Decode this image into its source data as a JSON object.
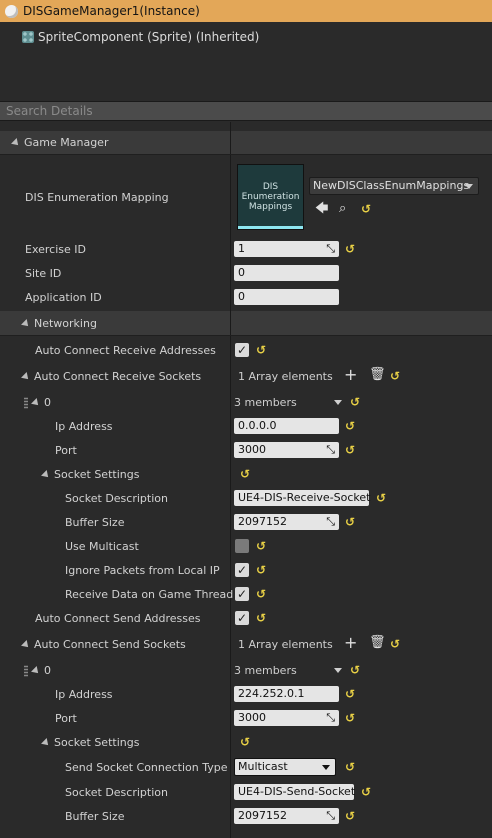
{
  "header": {
    "title": "DISGameManager1(Instance)",
    "component": "SpriteComponent (Sprite) (Inherited)"
  },
  "search": {
    "placeholder": "Search Details"
  },
  "game_manager": {
    "category": "Game Manager",
    "dis_enum_label": "DIS Enumeration Mapping",
    "thumbnail_text": [
      "DIS",
      "Enumeration",
      "Mappings"
    ],
    "asset_name": "NewDISClassEnumMappings",
    "exercise_label": "Exercise ID",
    "exercise_value": "1",
    "site_label": "Site ID",
    "site_value": "0",
    "application_label": "Application ID",
    "application_value": "0"
  },
  "networking": {
    "category": "Networking",
    "recv_addresses_label": "Auto Connect Receive Addresses",
    "recv_sockets_label": "Auto Connect Receive Sockets",
    "recv_sockets_count": "1 Array elements",
    "recv_index": "0",
    "recv_members": "3 members",
    "recv_ip_label": "Ip Address",
    "recv_ip_value": "0.0.0.0",
    "recv_port_label": "Port",
    "recv_port_value": "3000",
    "recv_socket_settings_label": "Socket Settings",
    "recv_desc_label": "Socket Description",
    "recv_desc_value": "UE4-DIS-Receive-Socket",
    "recv_buffer_label": "Buffer Size",
    "recv_buffer_value": "2097152",
    "use_multicast_label": "Use Multicast",
    "ignore_local_label": "Ignore Packets from Local IP",
    "game_thread_label": "Receive Data on Game Thread",
    "send_addresses_label": "Auto Connect Send Addresses",
    "send_sockets_label": "Auto Connect Send Sockets",
    "send_sockets_count": "1 Array elements",
    "send_index": "0",
    "send_members": "3 members",
    "send_ip_label": "Ip Address",
    "send_ip_value": "224.252.0.1",
    "send_port_label": "Port",
    "send_port_value": "3000",
    "send_socket_settings_label": "Socket Settings",
    "send_conn_type_label": "Send Socket Connection Type",
    "send_conn_type_value": "Multicast",
    "send_desc_label": "Socket Description",
    "send_desc_value": "UE4-DIS-Send-Socket",
    "send_buffer_label": "Buffer Size",
    "send_buffer_value": "2097152"
  },
  "icons": {
    "reset": "reset-to-default-icon",
    "add": "plus-icon",
    "delete": "trash-icon",
    "browse": "browse-icon",
    "use": "use-selected-icon"
  },
  "colors": {
    "title_bar": "#e3a758",
    "reset_arrow": "#e8d046",
    "thumbnail_underline": "#8de6f0"
  }
}
